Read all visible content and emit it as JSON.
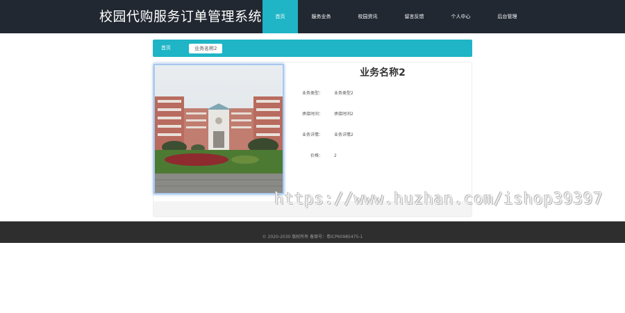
{
  "header": {
    "site_title": "校园代购服务订单管理系统",
    "nav": [
      {
        "label": "首页"
      },
      {
        "label": "服务业务"
      },
      {
        "label": "校园资讯"
      },
      {
        "label": "留言反馈"
      },
      {
        "label": "个人中心"
      },
      {
        "label": "后台管理"
      }
    ]
  },
  "breadcrumb": {
    "home": "首页",
    "current": "业务名称2"
  },
  "detail": {
    "title": "业务名称2",
    "fields": [
      {
        "label": "业务类型：",
        "value": "业务类型2"
      },
      {
        "label": "承接时间：",
        "value": "承接时间2"
      },
      {
        "label": "业务详情：",
        "value": "业务详情2"
      },
      {
        "label": "价格：",
        "value": "2"
      }
    ]
  },
  "watermark": "https://www.huzhan.com/ishop39397",
  "footer": {
    "copyright": "© 2020-2030 版权所有 备案号：粤ICP60985475-1"
  },
  "colors": {
    "accent": "#1fb5c6",
    "header_bg": "#222831",
    "footer_bg": "#2e2e2e"
  }
}
